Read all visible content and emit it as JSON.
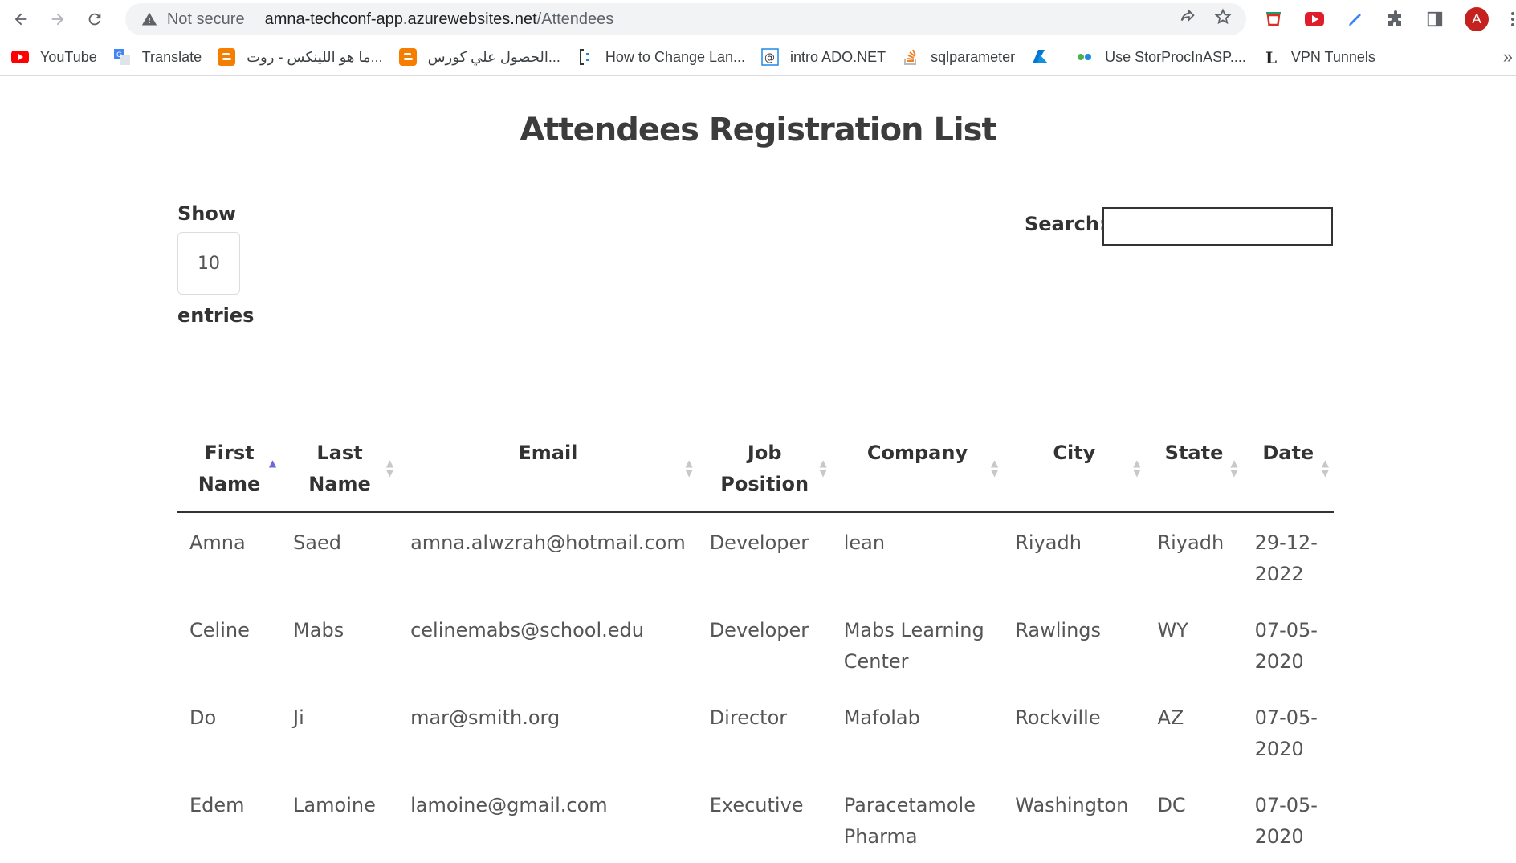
{
  "browser": {
    "not_secure": "Not secure",
    "url_host": "amna-techconf-app.azurewebsites.net",
    "url_path": "/Attendees",
    "avatar_letter": "A",
    "bookmarks": [
      {
        "label": "YouTube",
        "icon": "youtube-icon"
      },
      {
        "label": "Translate",
        "icon": "translate-icon"
      },
      {
        "label": "ما هو اللينكس - روت...",
        "icon": "blogger-icon"
      },
      {
        "label": "الحصول علي كورس...",
        "icon": "blogger-icon"
      },
      {
        "label": "How to Change Lan...",
        "icon": "bracket-icon"
      },
      {
        "label": "intro ADO.NET",
        "icon": "at-icon"
      },
      {
        "label": "sqlparameter",
        "icon": "stackoverflow-icon"
      },
      {
        "label": "",
        "icon": "azure-icon"
      },
      {
        "label": "Use StorProcInASP....",
        "icon": "link-icon"
      },
      {
        "label": "VPN Tunnels",
        "icon": "letter-l-icon"
      }
    ]
  },
  "page": {
    "title": "Attendees Registration List",
    "show_label": "Show",
    "length_value": "10",
    "entries_label": "entries",
    "search_label": "Search:",
    "search_value": ""
  },
  "table": {
    "columns": [
      {
        "line1": "First",
        "line2": "Name",
        "sorted": "asc"
      },
      {
        "line1": "Last",
        "line2": "Name",
        "sorted": ""
      },
      {
        "line1": "Email",
        "line2": "",
        "sorted": ""
      },
      {
        "line1": "Job",
        "line2": "Position",
        "sorted": ""
      },
      {
        "line1": "Company",
        "line2": "",
        "sorted": ""
      },
      {
        "line1": "City",
        "line2": "",
        "sorted": ""
      },
      {
        "line1": "State",
        "line2": "",
        "sorted": ""
      },
      {
        "line1": "Date",
        "line2": "",
        "sorted": ""
      }
    ],
    "rows": [
      [
        "Amna",
        "Saed",
        "amna.alwzrah@hotmail.com",
        "Developer",
        "lean",
        "Riyadh",
        "Riyadh",
        "29-12-2022"
      ],
      [
        "Celine",
        "Mabs",
        "celinemabs@school.edu",
        "Developer",
        "Mabs Learning Center",
        "Rawlings",
        "WY",
        "07-05-2020"
      ],
      [
        "Do",
        "Ji",
        "mar@smith.org",
        "Director",
        "Mafolab",
        "Rockville",
        "AZ",
        "07-05-2020"
      ],
      [
        "Edem",
        "Lamoine",
        "lamoine@gmail.com",
        "Executive",
        "Paracetamole Pharma",
        "Washington",
        "DC",
        "07-05-2020"
      ]
    ]
  }
}
